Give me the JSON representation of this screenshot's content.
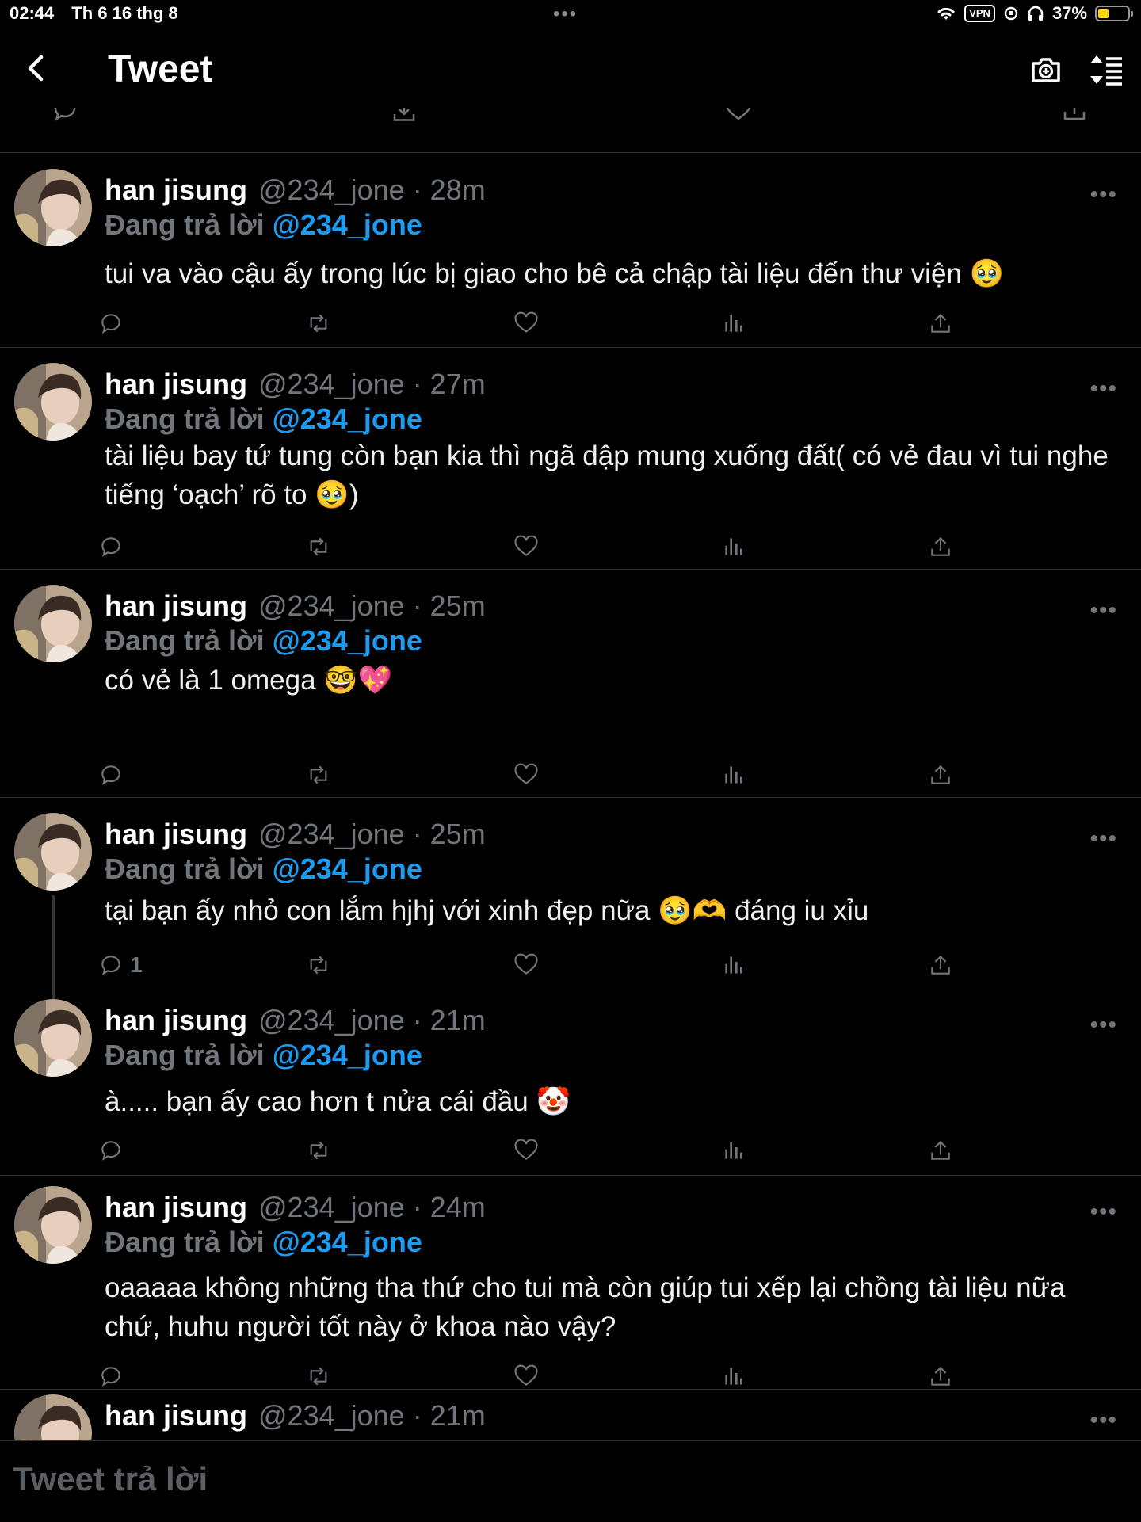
{
  "status_bar": {
    "time": "02:44",
    "date": "Th 6 16 thg 8",
    "vpn": "VPN",
    "battery": "37%",
    "battery_level": 0.37
  },
  "header": {
    "title": "Tweet",
    "back_icon": "chevron-left-icon",
    "camera_icon": "camera-plus-icon",
    "sort_icon": "sort-list-icon"
  },
  "tweets": [
    {
      "name": "han jisung",
      "meta": "@234_jone · 28m",
      "reply_prefix": "Đang trả lời",
      "mention": "@234_jone",
      "text": "tui va vào cậu ấy trong lúc bị giao cho bê cả chập tài liệu đến thư viện 🥹",
      "reply_count": ""
    },
    {
      "name": "han jisung",
      "meta": "@234_jone · 27m",
      "reply_prefix": "Đang trả lời",
      "mention": "@234_jone",
      "text": "tài liệu bay tứ tung còn bạn kia thì ngã dập mung xuống đất( có vẻ đau vì tui nghe tiếng ‘oạch’ rõ to 🥹)",
      "reply_count": ""
    },
    {
      "name": "han jisung",
      "meta": "@234_jone · 25m",
      "reply_prefix": "Đang trả lời",
      "mention": "@234_jone",
      "text": " có vẻ là 1 omega  🤓💖",
      "reply_count": ""
    },
    {
      "name": "han jisung",
      "meta": "@234_jone · 25m",
      "reply_prefix": "Đang trả lời",
      "mention": "@234_jone",
      "text": "tại bạn ấy nhỏ con lắm hjhj với xinh đẹp nữa 🥹🫶 đáng iu xỉu",
      "reply_count": "1"
    },
    {
      "name": "han jisung",
      "meta": "@234_jone · 21m",
      "reply_prefix": "Đang trả lời",
      "mention": "@234_jone",
      "text": "à..... bạn ấy cao hơn t nửa cái đầu 🤡",
      "reply_count": ""
    },
    {
      "name": "han jisung",
      "meta": "@234_jone · 24m",
      "reply_prefix": "Đang trả lời",
      "mention": "@234_jone",
      "text": "oaaaaa không những tha thứ cho tui mà còn giúp tui xếp lại chồng tài liệu nữa chứ, huhu người tốt này ở khoa nào vậy?",
      "reply_count": ""
    },
    {
      "name": "han jisung",
      "meta": "@234_jone · 21m",
      "reply_prefix": "",
      "mention": "",
      "text": "",
      "reply_count": ""
    }
  ],
  "composer": {
    "placeholder": "Tweet trả lời"
  },
  "icons": {
    "reply": "reply-icon",
    "retweet": "retweet-icon",
    "like": "heart-icon",
    "views": "analytics-icon",
    "share": "share-icon",
    "more": "more-icon"
  },
  "colors": {
    "background": "#000000",
    "mention": "#1d9bf0",
    "muted": "#71767b",
    "divider": "#2f3336"
  }
}
